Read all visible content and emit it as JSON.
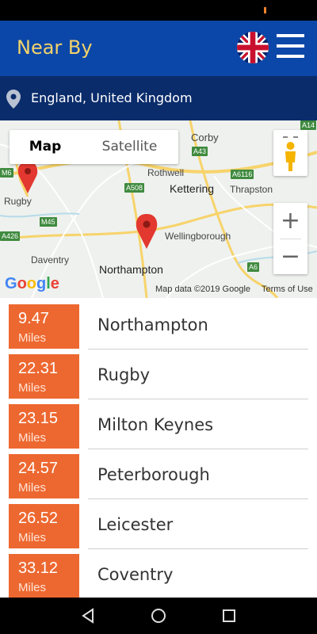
{
  "header": {
    "title": "Near By",
    "flag_icon": "uk-flag-icon",
    "menu_icon": "hamburger-menu-icon"
  },
  "location": {
    "icon": "location-pin-icon",
    "text": "England, United Kingdom"
  },
  "map": {
    "tabs": [
      "Map",
      "Satellite"
    ],
    "selected_tab": "Map",
    "zoom_in_label": "+",
    "zoom_out_label": "−",
    "labels": [
      "Corby",
      "Rothwell",
      "Kettering",
      "Thrapston",
      "Rugby",
      "Wellingborough",
      "Daventry",
      "Northampton"
    ],
    "road_badges": [
      "M6",
      "A43",
      "A6116",
      "A508",
      "M45",
      "A426",
      "A6",
      "A14"
    ],
    "logo": "Google",
    "attribution": "Map data ©2019 Google",
    "terms": "Terms of Use",
    "marker_color": "#e2382f"
  },
  "list": {
    "accent_color": "#ed6830",
    "items": [
      {
        "distance": "9.47",
        "unit": "Miles",
        "city": "Northampton"
      },
      {
        "distance": "22.31",
        "unit": "Miles",
        "city": "Rugby"
      },
      {
        "distance": "23.15",
        "unit": "Miles",
        "city": "Milton Keynes"
      },
      {
        "distance": "24.57",
        "unit": "Miles",
        "city": "Peterborough"
      },
      {
        "distance": "26.52",
        "unit": "Miles",
        "city": "Leicester"
      },
      {
        "distance": "33.12",
        "unit": "Miles",
        "city": "Coventry"
      }
    ]
  },
  "nav": {
    "back_icon": "back-triangle-icon",
    "home_icon": "home-circle-icon",
    "recents_icon": "recents-square-icon"
  }
}
